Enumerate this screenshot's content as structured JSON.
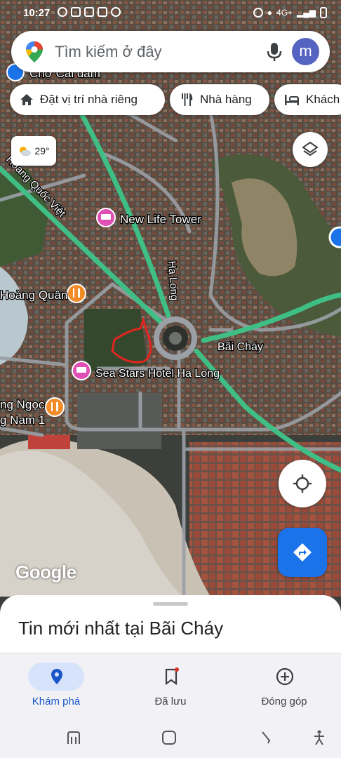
{
  "status_bar": {
    "time": "10:27",
    "signal_text": "4G+"
  },
  "search": {
    "placeholder": "Tìm kiếm ở đây",
    "avatar_letter": "m"
  },
  "chips": [
    {
      "label": "Đặt vị trí nhà riêng",
      "icon": "home-icon"
    },
    {
      "label": "Nhà hàng",
      "icon": "restaurant-icon"
    },
    {
      "label": "Khách",
      "icon": "hotel-icon"
    }
  ],
  "weather": {
    "temp": "29°",
    "icon": "partly-cloudy-icon"
  },
  "map": {
    "labels": {
      "cho_cai_dam": "Chợ Cái dăm",
      "hoang_quoc_viet": "Hoàng Quốc Việt",
      "new_life_tower": "New Life Tower",
      "ha_long": "Hạ Long",
      "hoang_quan": "Hoàng Quân",
      "bai_chay": "Bãi Cháy",
      "sea_stars": "Sea Stars Hotel Ha Long",
      "ngoc": "ng Ngọc",
      "nam": "g Nam 1"
    },
    "colors": {
      "road_green": "#3fbf86",
      "road_gray": "#9aa0a6",
      "hotel_pink": "#e04fb3",
      "food_orange": "#f28c28"
    }
  },
  "watermark": "Google",
  "sheet": {
    "title": "Tin mới nhất tại Bãi Cháy"
  },
  "bottom_nav": [
    {
      "label": "Khám phá",
      "icon": "explore-pin-icon",
      "active": true
    },
    {
      "label": "Đã lưu",
      "icon": "bookmark-icon",
      "active": false
    },
    {
      "label": "Đóng góp",
      "icon": "add-circle-icon",
      "active": false
    }
  ],
  "accent_color": "#1a73e8"
}
